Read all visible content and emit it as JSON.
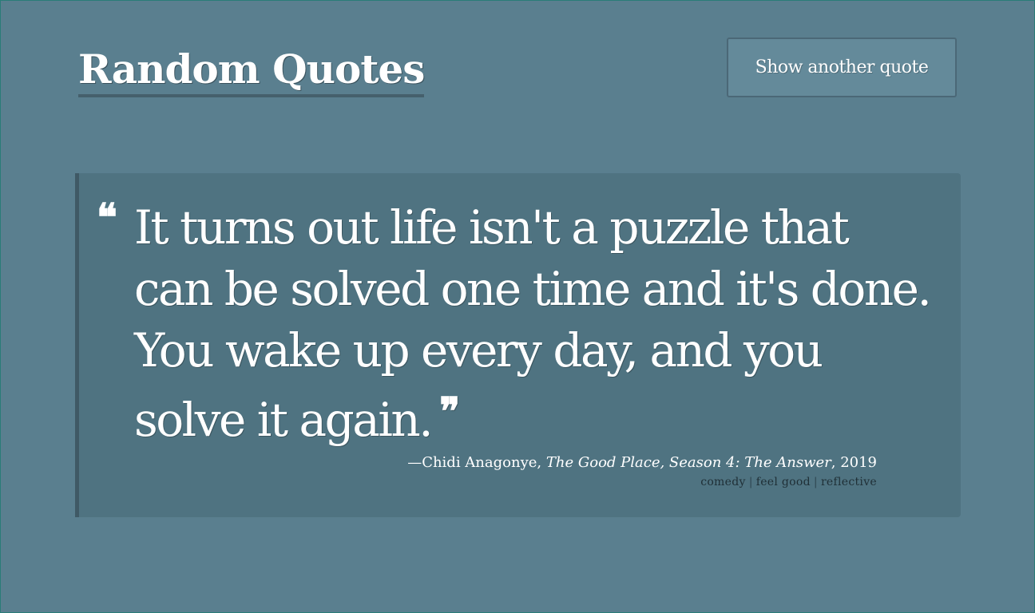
{
  "header": {
    "title": "Random Quotes",
    "button_label": "Show another quote"
  },
  "quote": {
    "open_mark": "❝",
    "text": "It turns out life isn't a puzzle that can be solved one time and it's done. You wake up every day, and you solve it again.",
    "close_mark": "❞",
    "dash": "—",
    "author": "Chidi Anagonye",
    "work": "The Good Place, Season 4: The Answer",
    "year": "2019",
    "tags": [
      "comedy",
      "feel good",
      "reflective"
    ],
    "tag_separator": "|"
  },
  "colors": {
    "background": "#5a7f8f",
    "card": "#4f7381",
    "card_border": "#3f5965",
    "button": "#648a9a",
    "text": "#ffffff",
    "tags_text": "#1f2f36"
  }
}
